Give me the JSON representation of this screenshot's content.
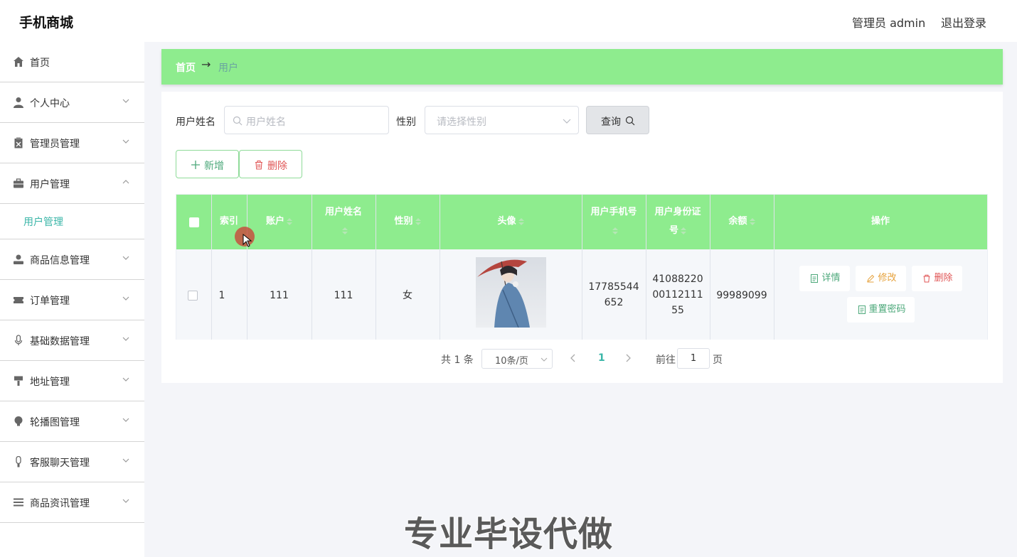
{
  "app": {
    "title": "手机商城"
  },
  "header": {
    "admin_label": "管理员 admin",
    "logout_label": "退出登录"
  },
  "sidebar": {
    "items": [
      {
        "label": "首页",
        "icon": "home-icon"
      },
      {
        "label": "个人中心",
        "icon": "user-icon"
      },
      {
        "label": "管理员管理",
        "icon": "clipboard-icon"
      },
      {
        "label": "用户管理",
        "icon": "briefcase-icon",
        "expanded": true
      },
      {
        "label": "用户管理",
        "icon": "",
        "sub": true,
        "active": true
      },
      {
        "label": "商品信息管理",
        "icon": "user-silhouette-icon"
      },
      {
        "label": "订单管理",
        "icon": "ticket-icon"
      },
      {
        "label": "基础数据管理",
        "icon": "microphone-icon"
      },
      {
        "label": "地址管理",
        "icon": "paint-roller-icon"
      },
      {
        "label": "轮播图管理",
        "icon": "lightbulb-icon"
      },
      {
        "label": "客服聊天管理",
        "icon": "mic-stand-icon"
      },
      {
        "label": "商品资讯管理",
        "icon": "list-icon"
      }
    ]
  },
  "breadcrumb": {
    "home": "首页",
    "arrow": "→",
    "current": "用户"
  },
  "search": {
    "name_label": "用户姓名",
    "name_placeholder": "用户姓名",
    "gender_label": "性别",
    "gender_placeholder": "请选择性别",
    "query_label": "查询"
  },
  "actions": {
    "add_label": "新增",
    "delete_label": "删除"
  },
  "table": {
    "headers": [
      "索引",
      "账户",
      "用户姓名",
      "性别",
      "头像",
      "用户手机号",
      "用户身份证号",
      "余额",
      "操作"
    ],
    "rows": [
      {
        "index": "1",
        "account": "111",
        "name": "111",
        "gender": "女",
        "phone_l1": "17785544",
        "phone_l2": "652",
        "id_l1": "41088220",
        "id_l2": "00112111",
        "id_l3": "55",
        "balance": "99989099",
        "ops": {
          "detail": "详情",
          "edit": "修改",
          "delete": "删除",
          "reset": "重置密码"
        }
      }
    ]
  },
  "pagination": {
    "total": "共 1 条",
    "page_size": "10条/页",
    "current_page": "1",
    "goto_label": "前往",
    "goto_value": "1",
    "page_suffix": "页"
  },
  "watermark": "专业毕设代做",
  "colors": {
    "accent_green": "#8eec8e",
    "active_teal": "#3bb6a8",
    "danger": "#e05555",
    "warning": "#e6a23c"
  }
}
